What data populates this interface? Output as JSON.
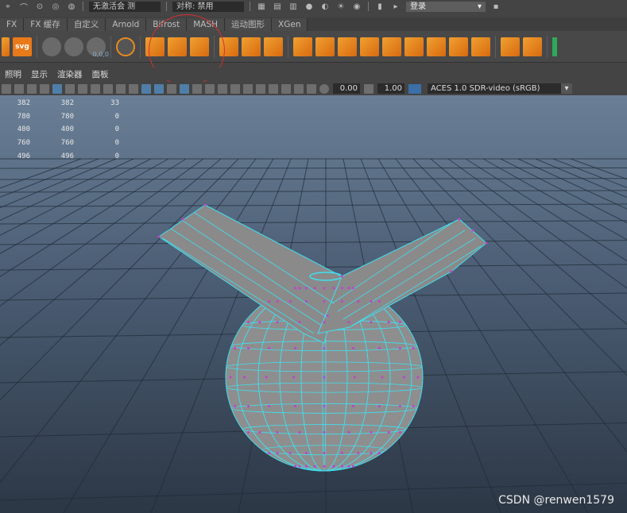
{
  "statusbar": {
    "object_field": "无激活会 测",
    "symmetry_field": "对称: 禁用",
    "login_label": "登录"
  },
  "shelf_tabs": [
    "FX",
    "FX 缓存",
    "自定义",
    "Arnold",
    "Bifrost",
    "MASH",
    "运动图形",
    "XGen"
  ],
  "shelf": {
    "svg_label": "svg",
    "tool_readout": "0,0,0"
  },
  "panel_menu": [
    "照明",
    "显示",
    "渲染器",
    "面板"
  ],
  "panel_toolbar": {
    "field_a": "0.00",
    "field_b": "1.00",
    "color_space": "ACES 1.0 SDR-video (sRGB)"
  },
  "hud": {
    "rows": [
      [
        "382",
        "382",
        "33"
      ],
      [
        "780",
        "780",
        "0"
      ],
      [
        "400",
        "400",
        "0"
      ],
      [
        "760",
        "760",
        "0"
      ],
      [
        "496",
        "496",
        "0"
      ]
    ]
  },
  "watermark": "CSDN @renwen1579",
  "colors": {
    "viewport_top": "#6a7f96",
    "viewport_bottom": "#2c3745",
    "wire": "#3fe0f0",
    "vertex": "#c040d0",
    "annotation": "#d43030",
    "accent_orange": "#e87a1a"
  }
}
